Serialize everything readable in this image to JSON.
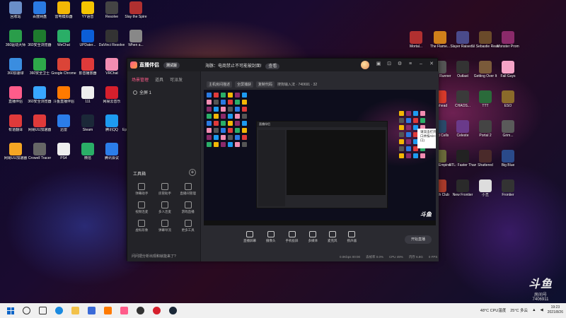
{
  "desktop": {
    "left_icons": [
      {
        "label": "回收站",
        "color": "#6a8ec8"
      },
      {
        "label": "百度网盘",
        "color": "#2a7ae2"
      },
      {
        "label": "雷电模拟器",
        "color": "#f2b705"
      },
      {
        "label": "YY语音",
        "color": "#f5c400"
      },
      {
        "label": "Resolve",
        "color": "#444"
      },
      {
        "label": "Slay the Spire",
        "color": "#b03030"
      },
      {
        "label": "360驱动大师",
        "color": "#2a9d4a"
      },
      {
        "label": "360安全浏览器",
        "color": "#1e7a2e"
      },
      {
        "label": "WeChat",
        "color": "#2aae67"
      },
      {
        "label": "UPDater...",
        "color": "#0b5ed7"
      },
      {
        "label": "DaVinci Resolve",
        "color": "#333"
      },
      {
        "label": "When a...",
        "color": "#888"
      },
      {
        "label": "360加速球",
        "color": "#3a8de0"
      },
      {
        "label": "360安全卫士",
        "color": "#2ea84a"
      },
      {
        "label": "Google Chrome",
        "color": "#db4437"
      },
      {
        "label": "影音播放器",
        "color": "#e03a3a"
      },
      {
        "label": "VRChat",
        "color": "#f28db2"
      },
      {
        "label": "60 Parsecs",
        "color": "#f2a900"
      },
      {
        "label": "直播伴侣",
        "color": "#ff5c8a"
      },
      {
        "label": "360安全浏览器",
        "color": "#38a6ff"
      },
      {
        "label": "斗鱼直播伴侣",
        "color": "#ff7a00"
      },
      {
        "label": "111",
        "color": "#eee"
      },
      {
        "label": "网易云音乐",
        "color": "#d61f2c"
      },
      {
        "label": "酷狗音乐",
        "color": "#1a7ae8"
      },
      {
        "label": "有道翻译",
        "color": "#e03a3a"
      },
      {
        "label": "网易UU加速器",
        "color": "#e03a3a"
      },
      {
        "label": "迅雷",
        "color": "#2b7de9"
      },
      {
        "label": "Steam",
        "color": "#1b2838"
      },
      {
        "label": "腾讯QQ",
        "color": "#1d9bf0"
      },
      {
        "label": "Epic Games Launcher",
        "color": "#222"
      },
      {
        "label": "网易UU加速器",
        "color": "#f5a623"
      },
      {
        "label": "Crowell Tracer",
        "color": "#666"
      },
      {
        "label": "PS4",
        "color": "#eee"
      },
      {
        "label": "微信",
        "color": "#2aae67"
      },
      {
        "label": "腾讯会议",
        "color": "#2b7de9"
      }
    ],
    "right_icons": [
      {
        "label": "Mortal...",
        "color": "#b03030"
      },
      {
        "label": "The Flame...",
        "color": "#d0801a"
      },
      {
        "label": "Slayer Raised...",
        "color": "#4a4a8a"
      },
      {
        "label": "Vi Sebastie Reanimated",
        "color": "#6a4a2a"
      },
      {
        "label": "Monster Prom",
        "color": "#8a2a6a"
      },
      {
        "label": "Merge & Blade",
        "color": "#b8a64a"
      },
      {
        "label": "Ghost Runner",
        "color": "#555"
      },
      {
        "label": "Outlast",
        "color": "#333"
      },
      {
        "label": "Getting Over It",
        "color": "#7a5a3a"
      },
      {
        "label": "Fall Guys",
        "color": "#f5a3c7"
      },
      {
        "label": "Hollow Knight",
        "color": "#4a5a7a"
      },
      {
        "label": "Cuphead",
        "color": "#d83a2a"
      },
      {
        "label": "CHAOS...",
        "color": "#3a3a3a"
      },
      {
        "label": "TTT",
        "color": "#2a6a3a"
      },
      {
        "label": "ESO",
        "color": "#8a6a2a"
      },
      {
        "label": "ANNE",
        "color": "#333"
      },
      {
        "label": "Dead Cells",
        "color": "#2a4a6a"
      },
      {
        "label": "Celeste",
        "color": "#6a3a8a"
      },
      {
        "label": "Portal 2",
        "color": "#444"
      },
      {
        "label": "Grim...",
        "color": "#5a5a5a"
      },
      {
        "label": "Not For Broadcast",
        "color": "#3a3a6a"
      },
      {
        "label": "Circle Empires",
        "color": "#6a6a3a"
      },
      {
        "label": "FTL: Faster Than Light",
        "color": "#222"
      },
      {
        "label": "Shattered",
        "color": "#4a2a2a"
      },
      {
        "label": "Big Blue",
        "color": "#2a4a8a"
      },
      {
        "label": "Delivery From...",
        "color": "#5a3a2a"
      },
      {
        "label": "Punch Club",
        "color": "#a83a2a"
      },
      {
        "label": "New Frontier",
        "color": "#2a2a2a"
      },
      {
        "label": "小丑",
        "color": "#ddd"
      },
      {
        "label": "Frontier",
        "color": "#333"
      }
    ]
  },
  "app": {
    "name": "直播伴侣",
    "beta": "测试版",
    "notice": "海豚：电商禁止不可能被封面!",
    "notice_action": "查看",
    "sidebar_tabs": [
      "场景管理",
      "道具",
      "可派发"
    ],
    "scene_label": "全屏 1",
    "tools_label": "工具箱",
    "tools": [
      "弹幕助手",
      "房管助手",
      "直播间管理",
      "视频连麦",
      "多人连麦",
      "游戏直播",
      "虚拟形象",
      "弹幕导流",
      "更多工具"
    ],
    "side_footer": "问问把分析出现和就能来了?",
    "preview_header_pills": [
      "主机房间描述",
      "全屏捕获",
      "复制代码"
    ],
    "preview_header_text": "搜狗输入法 · 740691 · 32",
    "tooltip": "请双击打开该程序，视频将设定十字准星，选择要放大的窗口并按Alt+Shift键调整截取区域并保存(Ctrl+V快速粘贴到窗口)",
    "preview_badge": "斗鱼",
    "controls": [
      "直播屏幕",
      "摄像头",
      "手机投屏",
      "多媒体",
      "麦克风",
      "扬声器"
    ],
    "live_button": "开始直播",
    "stats": [
      "0.0Kbps 00:00",
      "丢帧率 0.0%",
      "CPU 49%",
      "内存 6.8G",
      "0 FPS"
    ]
  },
  "taskbar": {
    "temp_label": "48°C CPU温度",
    "weather": "25°C 多云",
    "time": "19:23",
    "date": "2021/8/26"
  },
  "room": {
    "brand": "斗鱼",
    "label": "房间号",
    "number": "7406911"
  }
}
